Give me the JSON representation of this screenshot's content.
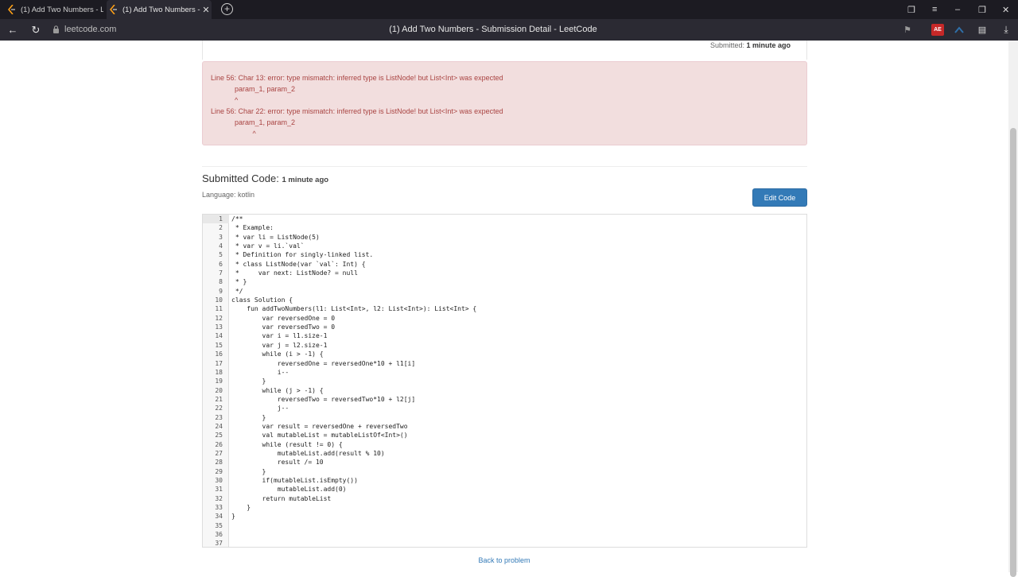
{
  "browser": {
    "tabs": [
      {
        "title": "(1) Add Two Numbers - Le",
        "active": false
      },
      {
        "title": "(1) Add Two Numbers -",
        "active": true
      }
    ],
    "url": "leetcode.com",
    "page_title": "(1) Add Two Numbers - Submission Detail - LeetCode",
    "extension_badge": "AE"
  },
  "submission": {
    "submitted_label": "Submitted:",
    "submitted_time": "1 minute ago",
    "errors": [
      "Line 56: Char 13: error: type mismatch: inferred type is ListNode! but List<Int> was expected",
      "            param_1, param_2",
      "            ^",
      "Line 56: Char 22: error: type mismatch: inferred type is ListNode! but List<Int> was expected",
      "            param_1, param_2",
      "                     ^"
    ],
    "code_heading": "Submitted Code:",
    "code_time": "1 minute ago",
    "language": "Language: kotlin",
    "edit_button": "Edit Code",
    "back_link": "Back to problem"
  },
  "code_lines": [
    "/**",
    " * Example:",
    " * var li = ListNode(5)",
    " * var v = li.`val`",
    " * Definition for singly-linked list.",
    " * class ListNode(var `val`: Int) {",
    " *     var next: ListNode? = null",
    " * }",
    " */",
    "class Solution {",
    "    fun addTwoNumbers(l1: List<Int>, l2: List<Int>): List<Int> {",
    "        var reversedOne = 0",
    "        var reversedTwo = 0",
    "        var i = l1.size-1",
    "        var j = l2.size-1",
    "        while (i > -1) {",
    "            reversedOne = reversedOne*10 + l1[i]",
    "            i--",
    "        }",
    "        while (j > -1) {",
    "            reversedTwo = reversedTwo*10 + l2[j]",
    "            j--",
    "        }",
    "        var result = reversedOne + reversedTwo",
    "        val mutableList = mutableListOf<Int>()",
    "        while (result != 0) {",
    "            mutableList.add(result % 10)",
    "            result /= 10",
    "        }",
    "        if(mutableList.isEmpty())",
    "            mutableList.add(0)",
    "        return mutableList",
    "    }",
    "}",
    "",
    "",
    ""
  ]
}
